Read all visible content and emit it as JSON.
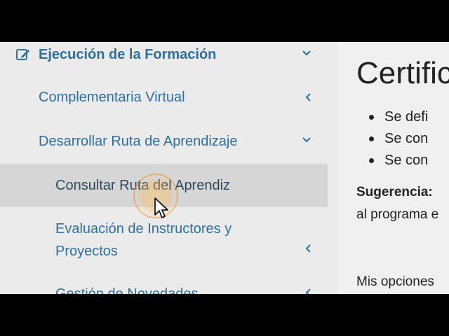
{
  "sidebar": {
    "section": {
      "label": "Ejecución de la Formación",
      "icon": "edit-icon",
      "chevron": "chevron-down-icon"
    },
    "items": [
      {
        "label": "Complementaria Virtual",
        "chevron": "chevron-left-icon"
      },
      {
        "label": "Desarrollar Ruta de Aprendizaje",
        "chevron": "chevron-down-icon"
      }
    ],
    "subitems": [
      {
        "label": "Consultar Ruta del Aprendiz",
        "active": true
      },
      {
        "label_line1": "Evaluación de Instructores y",
        "label_line2": "Proyectos",
        "chevron": "chevron-left-icon"
      },
      {
        "label": "Gestión de Novedades",
        "chevron": "chevron-left-icon"
      }
    ],
    "colors": {
      "link": "#2e6f9e",
      "active_bg": "#d6d6d6",
      "sidebar_bg": "#ebebeb"
    }
  },
  "content": {
    "title": "Certific",
    "bullets": [
      "Se defi",
      "Se con",
      "Se con"
    ],
    "suggestion_label": "Sugerencia:",
    "suggestion_text": "al programa e",
    "options_text": "Mis opciones"
  },
  "cursor": {
    "icon": "mouse-pointer-icon",
    "highlight": "click-highlight"
  }
}
